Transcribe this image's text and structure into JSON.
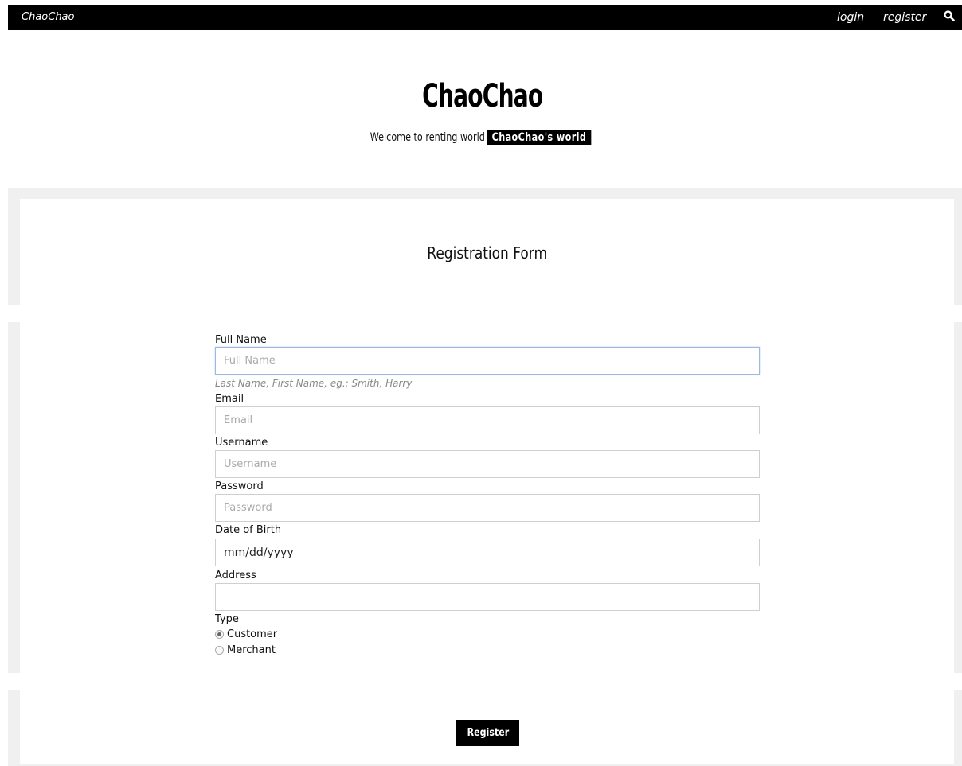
{
  "nav": {
    "brand": "ChaoChao",
    "login": "login",
    "register": "register"
  },
  "header": {
    "title": "ChaoChao",
    "tagline_prefix": "Welcome to renting world",
    "tagline_highlight": "ChaoChao's world"
  },
  "form": {
    "title": "Registration Form",
    "full_name": {
      "label": "Full Name",
      "placeholder": "Full Name",
      "value": "",
      "help": "Last Name, First Name, eg.: Smith, Harry"
    },
    "email": {
      "label": "Email",
      "placeholder": "Email",
      "value": ""
    },
    "username": {
      "label": "Username",
      "placeholder": "Username",
      "value": ""
    },
    "password": {
      "label": "Password",
      "placeholder": "Password",
      "value": ""
    },
    "dob": {
      "label": "Date of Birth",
      "value": "mm/dd/yyyy"
    },
    "address": {
      "label": "Address",
      "value": ""
    },
    "type": {
      "label": "Type",
      "options": [
        "Customer",
        "Merchant"
      ],
      "selected": "Customer"
    },
    "submit_label": "Register"
  },
  "icons": {
    "search": "search-icon"
  },
  "colors": {
    "topbar": "#000000",
    "panel_bg": "#f0f0f0",
    "button": "#000000",
    "focus_border": "#9fb8e0"
  }
}
